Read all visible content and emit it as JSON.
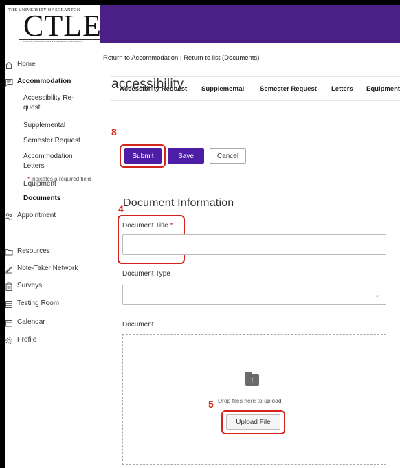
{
  "logo": {
    "top_text": "THE UNIVERSITY OF SCRANTON",
    "big_text": "CTLE",
    "bottom_text": "CENTER FOR TEACHING & LEARNING EXCELLENCE"
  },
  "sidebar": {
    "items": [
      {
        "label": "Home",
        "icon": "home-icon"
      },
      {
        "label": "Accommodation",
        "icon": "comment-icon"
      },
      {
        "label": "Appointment",
        "icon": "people-icon"
      },
      {
        "label": "Resources",
        "icon": "folder-icon"
      },
      {
        "label": "Note-Taker Network",
        "icon": "pencil-icon"
      },
      {
        "label": "Surveys",
        "icon": "clipboard-icon"
      },
      {
        "label": "Testing Room",
        "icon": "calendar-grid-icon"
      },
      {
        "label": "Calendar",
        "icon": "calendar-icon"
      },
      {
        "label": "Profile",
        "icon": "gear-icon"
      }
    ],
    "sub_items": [
      "Accessibility Re-quest",
      "Supplemental",
      "Semester Request",
      "Accommodation Letters",
      "Equipment",
      "Documents"
    ]
  },
  "main": {
    "breadcrumb": "Return to Accommodation | Return to list (Documents)",
    "page_title": "accessibility",
    "tabs": [
      "Accessibility Request",
      "Supplemental",
      "Semester Request",
      "Letters",
      "Equipment"
    ],
    "buttons": {
      "submit": "Submit",
      "save": "Save",
      "cancel": "Cancel",
      "upload": "Upload File"
    },
    "required_note_star": "*",
    "required_note": " indicates a required field",
    "section_title": "Document Information",
    "fields": {
      "document_title_label": "Document Title ",
      "required_star": "*",
      "document_type_label": "Document Type",
      "document_label": "Document"
    },
    "drop_text": "Drop files here to upload"
  },
  "annotations": {
    "submit_step": "8",
    "title_step": "4",
    "upload_step": "5"
  },
  "colors": {
    "brand_purple": "#4a1f86",
    "button_purple": "#4d1da6",
    "annotation_red": "#d4241c"
  }
}
